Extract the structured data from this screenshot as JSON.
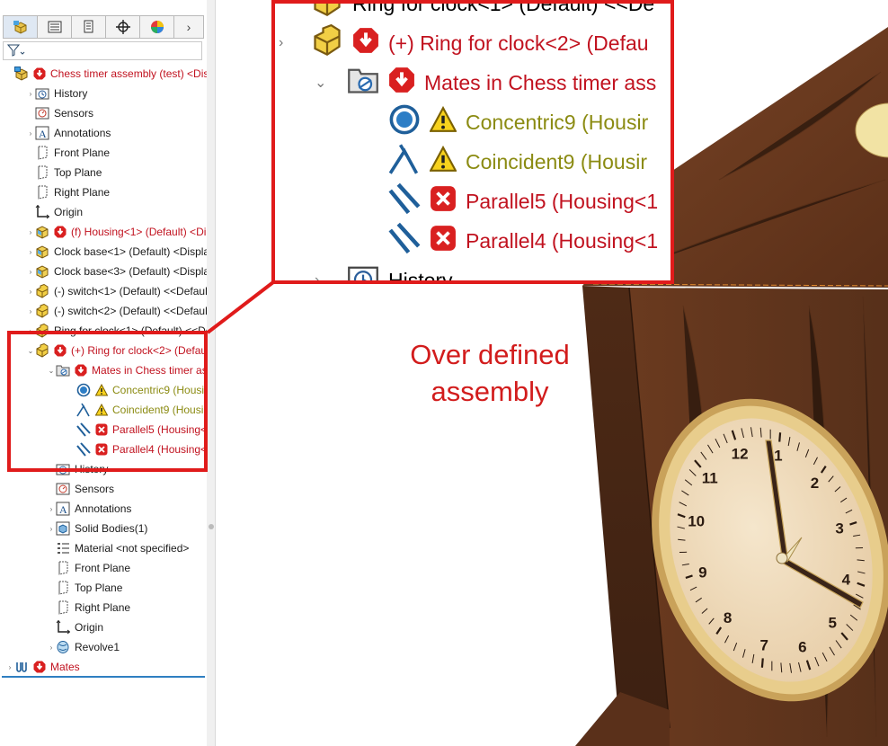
{
  "tabs": [
    {
      "icon": "feature-manager-icon"
    },
    {
      "icon": "property-manager-icon"
    },
    {
      "icon": "configuration-manager-icon"
    },
    {
      "icon": "dimxpert-icon"
    },
    {
      "icon": "display-manager-icon"
    }
  ],
  "more_tab": "›",
  "filter_icon": "funnel-icon",
  "tree": [
    {
      "label": "Chess timer assembly (test) <Disp",
      "color": "red",
      "indent": 0,
      "expander": "",
      "icon": "assembly-icon",
      "status": "error"
    },
    {
      "label": "History",
      "color": "black",
      "indent": 1,
      "expander": "›",
      "icon": "history-icon"
    },
    {
      "label": "Sensors",
      "color": "black",
      "indent": 1,
      "expander": "",
      "icon": "sensors-icon"
    },
    {
      "label": "Annotations",
      "color": "black",
      "indent": 1,
      "expander": "›",
      "icon": "annotations-icon"
    },
    {
      "label": "Front Plane",
      "color": "black",
      "indent": 1,
      "expander": "",
      "icon": "plane-icon"
    },
    {
      "label": "Top Plane",
      "color": "black",
      "indent": 1,
      "expander": "",
      "icon": "plane-icon"
    },
    {
      "label": "Right Plane",
      "color": "black",
      "indent": 1,
      "expander": "",
      "icon": "plane-icon"
    },
    {
      "label": "Origin",
      "color": "black",
      "indent": 1,
      "expander": "",
      "icon": "origin-icon"
    },
    {
      "label": "(f) Housing<1> (Default) <Di",
      "color": "red",
      "indent": 1,
      "expander": "›",
      "icon": "part-icon",
      "status": "error"
    },
    {
      "label": "Clock base<1> (Default) <Display",
      "color": "black",
      "indent": 1,
      "expander": "›",
      "icon": "part-icon"
    },
    {
      "label": "Clock base<3> (Default) <Display",
      "color": "black",
      "indent": 1,
      "expander": "›",
      "icon": "part-icon"
    },
    {
      "label": "(-) switch<1> (Default) <<Default",
      "color": "black",
      "indent": 1,
      "expander": "›",
      "icon": "part-yellow-icon"
    },
    {
      "label": "(-) switch<2> (Default) <<Default",
      "color": "black",
      "indent": 1,
      "expander": "›",
      "icon": "part-yellow-icon"
    },
    {
      "label": "Ring for clock<1> (Default) <<De",
      "color": "black",
      "indent": 1,
      "expander": "›",
      "icon": "part-yellow-icon"
    },
    {
      "label": "(+) Ring for clock<2> (Defau",
      "color": "red",
      "indent": 1,
      "expander": "⌄",
      "icon": "part-yellow-icon",
      "status": "error"
    },
    {
      "label": "Mates in Chess timer ass",
      "color": "red",
      "indent": 2,
      "expander": "⌄",
      "icon": "mates-folder-icon",
      "status": "error"
    },
    {
      "label": "Concentric9 (Housin",
      "color": "olive",
      "indent": 3,
      "expander": "",
      "icon": "concentric-icon",
      "status": "warning"
    },
    {
      "label": "Coincident9 (Housin",
      "color": "olive",
      "indent": 3,
      "expander": "",
      "icon": "coincident-icon",
      "status": "warning"
    },
    {
      "label": "Parallel5 (Housing<1",
      "color": "red",
      "indent": 3,
      "expander": "",
      "icon": "parallel-icon",
      "status": "fail"
    },
    {
      "label": "Parallel4 (Housing<1",
      "color": "red",
      "indent": 3,
      "expander": "",
      "icon": "parallel-icon",
      "status": "fail"
    },
    {
      "label": "History",
      "color": "black",
      "indent": 2,
      "expander": "›",
      "icon": "history-icon"
    },
    {
      "label": "Sensors",
      "color": "black",
      "indent": 2,
      "expander": "",
      "icon": "sensors-icon"
    },
    {
      "label": "Annotations",
      "color": "black",
      "indent": 2,
      "expander": "›",
      "icon": "annotations-icon"
    },
    {
      "label": "Solid Bodies(1)",
      "color": "black",
      "indent": 2,
      "expander": "›",
      "icon": "solid-bodies-icon"
    },
    {
      "label": "Material <not specified>",
      "color": "black",
      "indent": 2,
      "expander": "",
      "icon": "material-icon"
    },
    {
      "label": "Front Plane",
      "color": "black",
      "indent": 2,
      "expander": "",
      "icon": "plane-icon"
    },
    {
      "label": "Top Plane",
      "color": "black",
      "indent": 2,
      "expander": "",
      "icon": "plane-icon"
    },
    {
      "label": "Right Plane",
      "color": "black",
      "indent": 2,
      "expander": "",
      "icon": "plane-icon"
    },
    {
      "label": "Origin",
      "color": "black",
      "indent": 2,
      "expander": "",
      "icon": "origin-icon"
    },
    {
      "label": "Revolve1",
      "color": "black",
      "indent": 2,
      "expander": "›",
      "icon": "revolve-icon"
    },
    {
      "label": "Mates",
      "color": "red",
      "indent": 0,
      "expander": "›",
      "icon": "mates-icon",
      "status": "error"
    }
  ],
  "zoom": [
    {
      "label": "Ring for clock<1> (Default) <<De",
      "color": "black",
      "icon": "part-yellow-icon"
    },
    {
      "label": "(+) Ring for clock<2> (Defau",
      "color": "red",
      "icon": "part-yellow-icon",
      "status": "error"
    },
    {
      "label": "Mates in Chess timer ass",
      "color": "red",
      "icon": "mates-folder-icon",
      "status": "error"
    },
    {
      "label": "Concentric9 (Housir",
      "color": "olive",
      "icon": "concentric-icon",
      "status": "warning"
    },
    {
      "label": "Coincident9 (Housir",
      "color": "olive",
      "icon": "coincident-icon",
      "status": "warning"
    },
    {
      "label": "Parallel5 (Housing<1",
      "color": "red",
      "icon": "parallel-icon",
      "status": "fail"
    },
    {
      "label": "Parallel4 (Housing<1",
      "color": "red",
      "icon": "parallel-icon",
      "status": "fail"
    },
    {
      "label": "History",
      "color": "black",
      "icon": "history-icon"
    }
  ],
  "caption": {
    "line1": "Over defined",
    "line2": "assembly"
  },
  "clock_numbers": [
    "12",
    "1",
    "2",
    "3",
    "4",
    "5",
    "6",
    "7",
    "8",
    "9",
    "10",
    "11"
  ],
  "colors": {
    "highlight": "#e01b1b",
    "error_text": "#c1121f",
    "warning_text": "#8b8b12",
    "wood": "#6b3a1e",
    "dial": "#efd9b8",
    "bezel": "#d9b870"
  }
}
